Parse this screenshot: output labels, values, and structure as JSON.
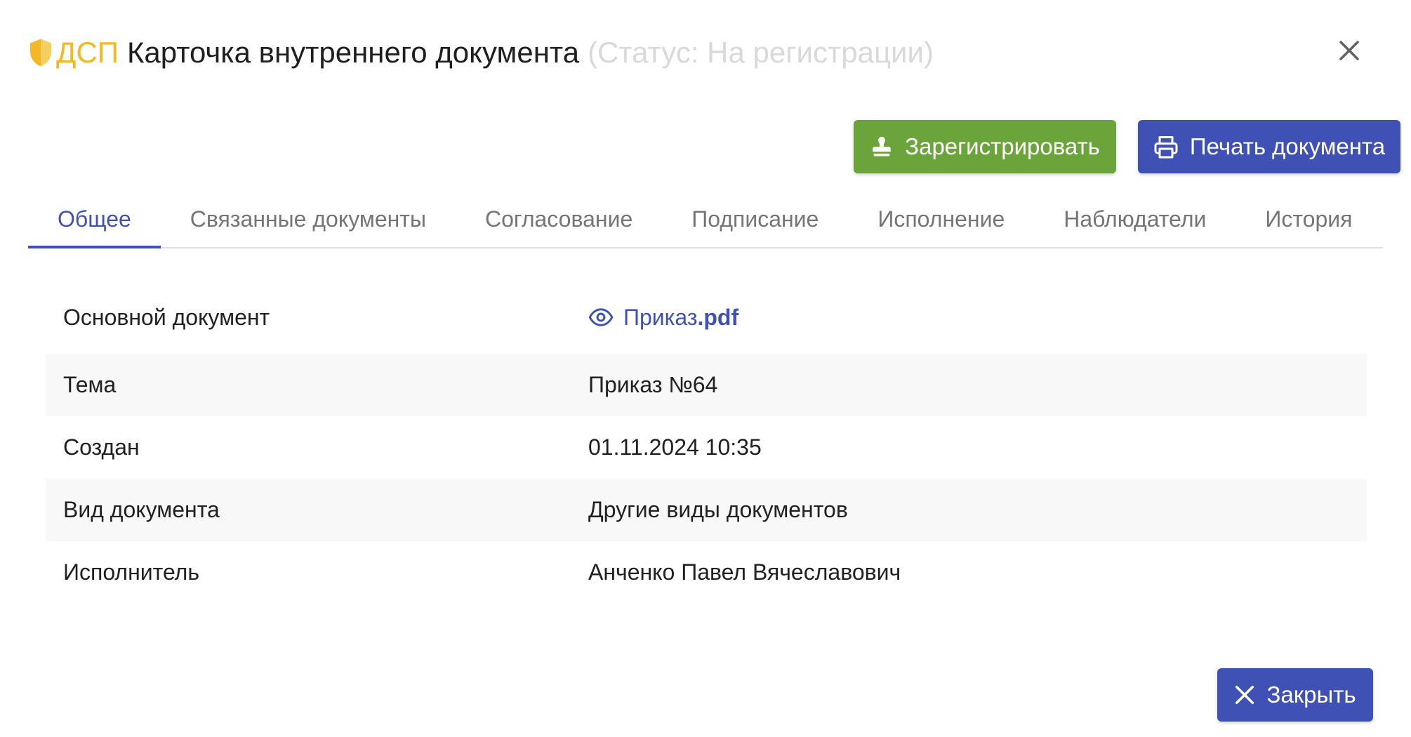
{
  "header": {
    "dsp_label": "ДСП",
    "title": "Карточка внутреннего документа",
    "status": "(Статус: На регистрации)"
  },
  "actions": {
    "register_label": "Зарегистрировать",
    "print_label": "Печать документа",
    "close_label": "Закрыть"
  },
  "tabs": [
    {
      "label": "Общее",
      "active": true
    },
    {
      "label": "Связанные документы",
      "active": false
    },
    {
      "label": "Согласование",
      "active": false
    },
    {
      "label": "Подписание",
      "active": false
    },
    {
      "label": "Исполнение",
      "active": false
    },
    {
      "label": "Наблюдатели",
      "active": false
    },
    {
      "label": "История",
      "active": false
    }
  ],
  "properties": {
    "main_document": {
      "label": "Основной документ",
      "file_name": "Приказ",
      "file_ext": ".pdf"
    },
    "rows": [
      {
        "label": "Тема",
        "value": "Приказ №64"
      },
      {
        "label": "Создан",
        "value": "01.11.2024 10:35"
      },
      {
        "label": "Вид документа",
        "value": "Другие виды документов"
      },
      {
        "label": "Исполнитель",
        "value": "Анченко Павел Вячеславович"
      }
    ]
  },
  "icons": {
    "shield": "shield-icon",
    "close": "close-icon",
    "register": "stamp-icon",
    "print": "printer-icon",
    "view": "eye-icon"
  },
  "colors": {
    "accent": "#3f51b5",
    "register": "#6ba43a",
    "dsp": "#f2b825",
    "status": "#d9d9d9"
  }
}
